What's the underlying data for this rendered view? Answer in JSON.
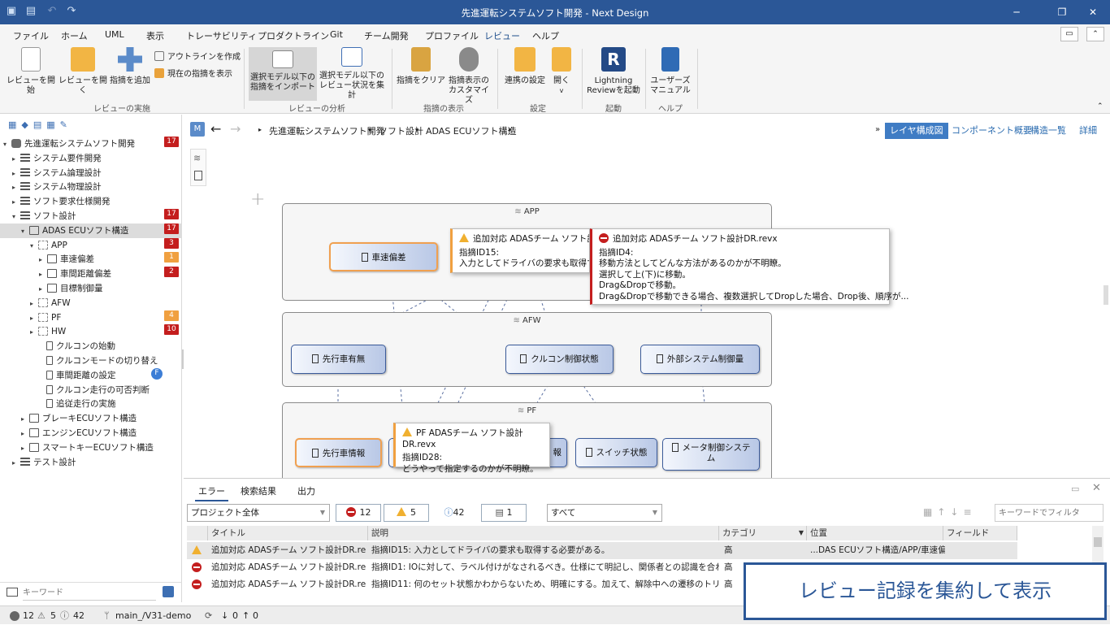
{
  "window": {
    "title": "先進運転システムソフト開発 - Next Design"
  },
  "menu": [
    "ファイル",
    "ホーム",
    "UML",
    "表示",
    "トレーサビリティ",
    "プロダクトライン",
    "Git",
    "チーム開発",
    "プロファイル",
    "レビュー",
    "ヘルプ"
  ],
  "ribbon": {
    "start": "レビューを開始",
    "open": "レビューを開く",
    "add": "指摘を追加",
    "create_outline": "アウトラインを作成",
    "show_current": "現在の指摘を表示",
    "group_exec": "レビューの実施",
    "import_1": "選択モデル以下の",
    "import_2": "指摘をインポート",
    "status_1": "選択モデル以下の",
    "status_2": "レビュー状況を集計",
    "group_analysis": "レビューの分析",
    "clear": "指摘をクリア",
    "custom_1": "指摘表示の",
    "custom_2": "カスタマイズ",
    "group_display": "指摘の表示",
    "conn": "連携の設定",
    "open2": "開く",
    "group_settings": "設定",
    "lr_1": "Lightning",
    "lr_2": "Reviewを起動",
    "group_launch": "起動",
    "um_1": "ユーザーズ",
    "um_2": "マニュアル",
    "group_help": "ヘルプ"
  },
  "tree": [
    {
      "label": "先進運転システムソフト開発",
      "badge": "17"
    },
    {
      "label": "システム要件開発"
    },
    {
      "label": "システム論理設計"
    },
    {
      "label": "システム物理設計"
    },
    {
      "label": "ソフト要求仕様開発"
    },
    {
      "label": "ソフト設計",
      "badge": "17"
    },
    {
      "label": "ADAS ECUソフト構造",
      "badge": "17"
    },
    {
      "label": "APP",
      "badge": "3"
    },
    {
      "label": "車速偏差",
      "badge": "1"
    },
    {
      "label": "車間距離偏差",
      "badge": "2"
    },
    {
      "label": "目標制御量"
    },
    {
      "label": "AFW"
    },
    {
      "label": "PF",
      "badge": "4"
    },
    {
      "label": "HW",
      "badge": "10"
    },
    {
      "label": "クルコンの始動"
    },
    {
      "label": "クルコンモードの切り替え"
    },
    {
      "label": "車間距離の設定",
      "badge": "F"
    },
    {
      "label": "クルコン走行の可否判断"
    },
    {
      "label": "追従走行の実施"
    },
    {
      "label": "ブレーキECUソフト構造"
    },
    {
      "label": "エンジンECUソフト構造"
    },
    {
      "label": "スマートキーECUソフト構造"
    },
    {
      "label": "テスト設計"
    }
  ],
  "search_placeholder": "キーワード",
  "canvas": {
    "m_label": "M",
    "breadcrumb": [
      "先進運転システムソフト開発",
      "ソフト設計",
      "ADAS ECUソフト構造"
    ],
    "view_tabs": [
      "レイヤ構成図",
      "コンポーネント概要",
      "構造一覧",
      "詳細"
    ],
    "pkg_app": "APP",
    "pkg_afw": "AFW",
    "pkg_pf": "PF",
    "comp_speed": "車速偏差",
    "comp_lead": "先行車有無",
    "comp_cc": "クルコン制御状態",
    "comp_ext": "外部システム制御量",
    "comp_leadinfo": "先行車情報",
    "comp_info": "報",
    "comp_switch": "スイッチ状態",
    "comp_meter_1": "メータ制御システ",
    "comp_meter_2": "ム",
    "pop1_head": "追加対応 ADASチーム ソフト設計",
    "pop1_l1": "指摘ID15:",
    "pop1_l2": "入力としてドライバの要求も取得する必",
    "pop2_head": "追加対応 ADASチーム ソフト設計DR.revx",
    "pop2_lines": [
      "指摘ID4:",
      "移動方法としてどんな方法があるのかが不明瞭。",
      "選択して上(下)に移動。",
      "Drag&Dropで移動。",
      "Drag&Dropで移動できる場合、複数選択してDropした場合、Drop後、順序が..."
    ],
    "pop3_head": "PF ADASチーム ソフト設計DR.revx",
    "pop3_l1": "指摘ID28:",
    "pop3_l2": "どうやって指定するのかが不明瞭。"
  },
  "bottom": {
    "tabs": [
      "エラー",
      "検索結果",
      "出力"
    ],
    "scope": "プロジェクト全体",
    "errors": "12",
    "warnings": "5",
    "infos": "42",
    "others": "1",
    "filter_all": "すべて",
    "filter_placeholder": "キーワードでフィルタ",
    "headers": [
      "タイトル",
      "説明",
      "カテゴリ",
      "位置",
      "フィールド"
    ],
    "rows": [
      {
        "type": "warn",
        "title": "追加対応 ADASチーム ソフト設計DR.revx",
        "desc": "指摘ID15: 入力としてドライバの要求も取得する必要がある。",
        "cat": "高",
        "pos": "...DAS ECUソフト構造/APP/車速偏差"
      },
      {
        "type": "err",
        "title": "追加対応 ADASチーム ソフト設計DR.revx",
        "desc": "指摘ID1: IOに対して、ラベル付けがなされるべき。仕様にて明記し、関係者との認識を合わせること。",
        "cat": "高",
        "pos": ""
      },
      {
        "type": "err",
        "title": "追加対応 ADASチーム ソフト設計DR.revx",
        "desc": "指摘ID11: 何のセット状態かわからないため、明確にする。加えて、解除中への遷移のトリガは、アク...",
        "cat": "高",
        "pos": ""
      }
    ]
  },
  "status": {
    "errors": "12",
    "warnings": "5",
    "infos": "42",
    "branch": "main_/V31-demo",
    "down": "0",
    "up": "0"
  },
  "banner": "レビュー記録を集約して表示",
  "colors": {
    "accent": "#2b5797",
    "error": "#c41e1e",
    "warning": "#f0a040"
  }
}
